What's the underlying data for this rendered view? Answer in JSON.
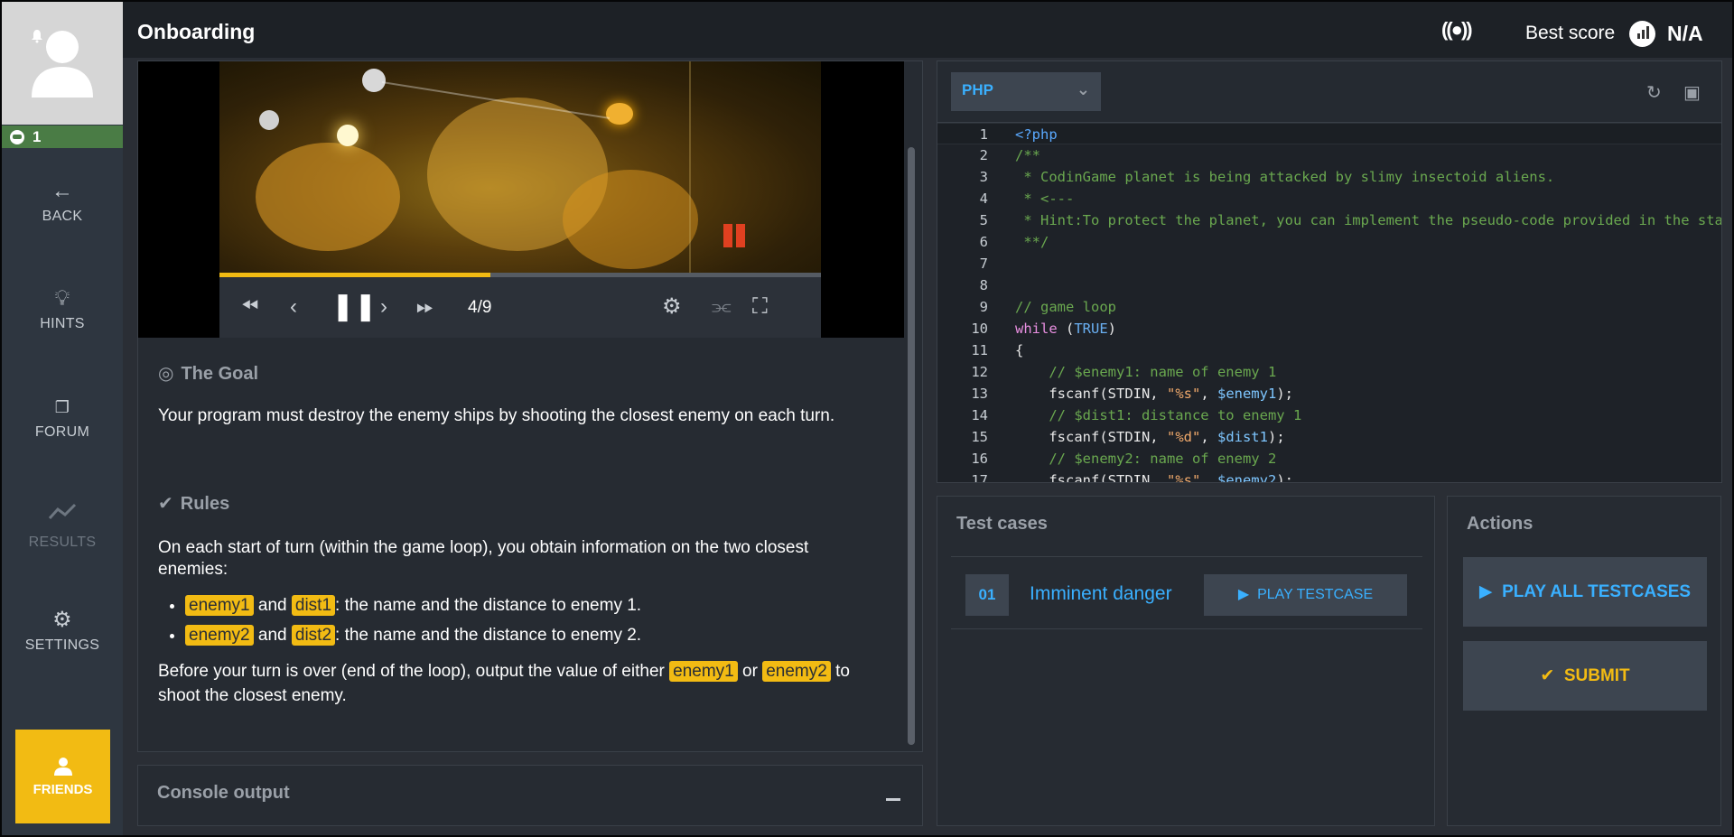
{
  "sidebar": {
    "level": "1",
    "nav": [
      {
        "label": "BACK",
        "icon": "back-arrow-icon",
        "enabled": true
      },
      {
        "label": "HINTS",
        "icon": "lightbulb-icon",
        "enabled": true
      },
      {
        "label": "FORUM",
        "icon": "forum-icon",
        "enabled": true
      },
      {
        "label": "RESULTS",
        "icon": "results-chart-icon",
        "enabled": false
      },
      {
        "label": "SETTINGS",
        "icon": "gear-icon",
        "enabled": true
      }
    ],
    "friends_label": "FRIENDS"
  },
  "header": {
    "title": "Onboarding",
    "best_score_label": "Best score",
    "best_score_value": "N/A"
  },
  "viewer": {
    "frame": "4/9",
    "progress": 0.45
  },
  "statement": {
    "goal_title": "The Goal",
    "goal_text": "Your program must destroy the enemy ships by shooting the closest enemy on each turn.",
    "rules_title": "Rules",
    "rules_intro": "On each start of turn (within the game loop), you obtain information on the two closest enemies:",
    "bullets": [
      {
        "a": "enemy1",
        "and": "and",
        "b": "dist1",
        "rest": ": the name and the distance to enemy 1."
      },
      {
        "a": "enemy2",
        "and": "and",
        "b": "dist2",
        "rest": ": the name and the distance to enemy 2."
      }
    ],
    "output_pre": "Before your turn is over (end of the loop), output the value of either",
    "output_var1": "enemy1",
    "output_or": "or",
    "output_var2": "enemy2",
    "output_post": "to shoot the closest enemy."
  },
  "console": {
    "title": "Console output"
  },
  "editor": {
    "language": "PHP",
    "lines": [
      {
        "n": "1",
        "html": "<span class=\"c-php\">&lt;?php</span>"
      },
      {
        "n": "2",
        "html": "<span class=\"c-cm\">/**</span>"
      },
      {
        "n": "3",
        "html": "<span class=\"c-cm\"> * CodinGame planet is being attacked by slimy insectoid aliens.</span>"
      },
      {
        "n": "4",
        "html": "<span class=\"c-cm\"> * &lt;---</span>"
      },
      {
        "n": "5",
        "html": "<span class=\"c-cm\"> * Hint:To protect the planet, you can implement the pseudo-code provided in the statement, below the player.</span>"
      },
      {
        "n": "6",
        "html": "<span class=\"c-cm\"> **/</span>"
      },
      {
        "n": "7",
        "html": ""
      },
      {
        "n": "8",
        "html": ""
      },
      {
        "n": "9",
        "html": "<span class=\"c-cm\">// game loop</span>"
      },
      {
        "n": "10",
        "html": "<span class=\"c-kw\">while</span> (<span class=\"c-const\">TRUE</span>)"
      },
      {
        "n": "11",
        "html": "{"
      },
      {
        "n": "12",
        "html": "    <span class=\"c-cm\">// $enemy1: name of enemy 1</span>"
      },
      {
        "n": "13",
        "html": "    fscanf(STDIN, <span class=\"c-str\">\"%s\"</span>, <span class=\"c-var\">$enemy1</span>);"
      },
      {
        "n": "14",
        "html": "    <span class=\"c-cm\">// $dist1: distance to enemy 1</span>"
      },
      {
        "n": "15",
        "html": "    fscanf(STDIN, <span class=\"c-str\">\"%d\"</span>, <span class=\"c-var\">$dist1</span>);"
      },
      {
        "n": "16",
        "html": "    <span class=\"c-cm\">// $enemy2: name of enemy 2</span>"
      },
      {
        "n": "17",
        "html": "    fscanf(STDIN, <span class=\"c-str\">\"%s\"</span>, <span class=\"c-var\">$enemy2</span>);"
      }
    ]
  },
  "tests": {
    "title": "Test cases",
    "items": [
      {
        "num": "01",
        "name": "Imminent danger",
        "play_label": "PLAY TESTCASE"
      }
    ]
  },
  "actions": {
    "title": "Actions",
    "play_all_label": "PLAY ALL TESTCASES",
    "submit_label": "SUBMIT"
  },
  "colors": {
    "accent": "#f2bb13",
    "link": "#3ab0ff",
    "level_bg": "#4a7c45"
  }
}
